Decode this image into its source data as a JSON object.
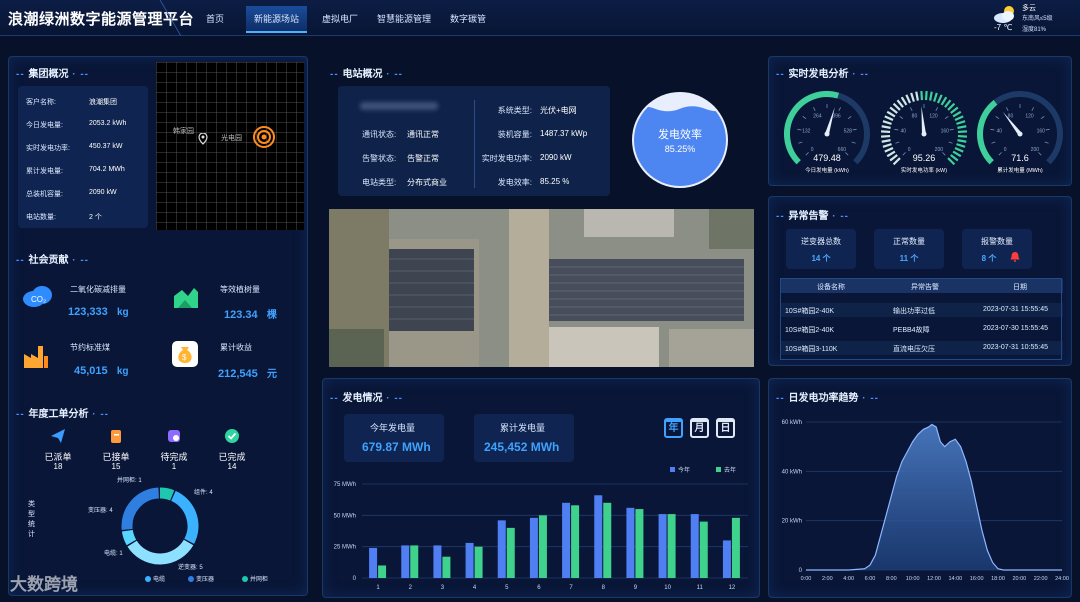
{
  "header": {
    "title": "浪潮绿洲数字能源管理平台",
    "nav": [
      "首页",
      "新能源场站",
      "虚拟电厂",
      "智慧能源管理",
      "数字碳管"
    ],
    "active_nav": 1,
    "weather": {
      "condition": "多云",
      "wind": "东南风≤5级",
      "temp": "-7 ℃",
      "humidity": "湿度81%"
    }
  },
  "group": {
    "title": "集团概况",
    "rows": [
      {
        "label": "客户名称:",
        "value": "浪潮集团"
      },
      {
        "label": "今日发电量:",
        "value": "2053.2 kWh"
      },
      {
        "label": "实时发电功率:",
        "value": "450.37 kW"
      },
      {
        "label": "累计发电量:",
        "value": "704.2 MWh"
      },
      {
        "label": "总装机容量:",
        "value": "2090 kW"
      },
      {
        "label": "电站数量:",
        "value": "2 个"
      }
    ],
    "map_labels": [
      "韩家园",
      "光电园"
    ]
  },
  "social": {
    "title": "社会贡献",
    "items": [
      {
        "label": "二氧化碳减排量",
        "value": "123,333",
        "unit": "kg",
        "icon": "co2-icon",
        "color": "#2f8cff"
      },
      {
        "label": "等效植树量",
        "value": "123.34",
        "unit": "棵",
        "icon": "tree-icon",
        "color": "#2fd48a"
      },
      {
        "label": "节约标准煤",
        "value": "45,015",
        "unit": "kg",
        "icon": "factory-icon",
        "color": "#ffa531"
      },
      {
        "label": "累计收益",
        "value": "212,545",
        "unit": "元",
        "icon": "money-bag-icon",
        "color": "#ffb531"
      }
    ],
    "co2_text": "CO₂"
  },
  "workorder": {
    "title": "年度工单分析",
    "stats": [
      {
        "label": "已派单",
        "value": "18",
        "icon": "send-icon",
        "color": "#3b9dff"
      },
      {
        "label": "已接单",
        "value": "15",
        "icon": "clipboard-icon",
        "color": "#ff9a3c"
      },
      {
        "label": "待完成",
        "value": "1",
        "icon": "clock-icon",
        "color": "#8c6bff"
      },
      {
        "label": "已完成",
        "value": "14",
        "icon": "check-icon",
        "color": "#2fd4a0"
      }
    ],
    "type_label": "类型统计",
    "donut_labels": [
      {
        "text": "并网柜: 1"
      },
      {
        "text": "组件: 4"
      },
      {
        "text": "变压器: 4"
      },
      {
        "text": "电缆: 1"
      },
      {
        "text": "逆变器: 5"
      }
    ],
    "legend": [
      "电缆",
      "变压器",
      "并网柜"
    ],
    "colors": [
      "#3bb2ff",
      "#58d6ff",
      "#2f7fe0",
      "#1fc7b0",
      "#8ee0ff"
    ]
  },
  "station": {
    "title": "电站概况",
    "name_blurred": "",
    "left_rows": [
      {
        "label": "通讯状态:",
        "value": "通讯正常"
      },
      {
        "label": "告警状态:",
        "value": "告警正常"
      },
      {
        "label": "电站类型:",
        "value": "分布式商业"
      }
    ],
    "right_rows": [
      {
        "label": "系统类型:",
        "value": "光伏+电网"
      },
      {
        "label": "装机容量:",
        "value": "1487.37 kWp"
      },
      {
        "label": "实时发电功率:",
        "value": "2090 kW"
      },
      {
        "label": "发电效率:",
        "value": "85.25 %"
      }
    ],
    "efficiency": {
      "label": "发电效率",
      "value": "85.25%",
      "fraction": 0.8525
    }
  },
  "power": {
    "title": "发电情况",
    "year_label": "今年发电量",
    "year_value": "679.87 MWh",
    "total_label": "累计发电量",
    "total_value": "245,452 MWh",
    "period_buttons": [
      "年",
      "月",
      "日"
    ]
  },
  "realtime": {
    "title": "实时发电分析",
    "gauges": [
      {
        "label": "今日发电量 (kWh)",
        "value": "479.48",
        "fraction": 0.56,
        "color": "#3fcf9a",
        "ticks": [
          "0",
          "132",
          "264",
          "396",
          "528",
          "660"
        ]
      },
      {
        "label": "实时发电功率 (kW)",
        "value": "95.26",
        "fraction": 0.48,
        "color": "#bfe6e0",
        "ticks": [
          "0",
          "40",
          "80",
          "120",
          "160",
          "200"
        ]
      },
      {
        "label": "累计发电量 (MWh)",
        "value": "71.6",
        "fraction": 0.36,
        "color": "#3fcf9a",
        "ticks": [
          "0",
          "40",
          "80",
          "120",
          "160",
          "200"
        ]
      }
    ]
  },
  "alarm": {
    "title": "异常告警",
    "stats": [
      {
        "label": "逆变器总数",
        "value": "14 个"
      },
      {
        "label": "正常数量",
        "value": "11 个"
      },
      {
        "label": "报警数量",
        "value": "8 个"
      }
    ],
    "columns": [
      "设备名称",
      "异常告警",
      "日期"
    ],
    "rows": [
      [
        "10S#箱园2-40K",
        "输出功率过低",
        "2023-07-31 15:55:45"
      ],
      [
        "10S#箱园2-40K",
        "PEBB4故障",
        "2023-07-30 15:55:45"
      ],
      [
        "10S#箱园3-110K",
        "直流电压欠压",
        "2023-07-31 10:55:45"
      ]
    ]
  },
  "trend": {
    "title": "日发电功率趋势"
  },
  "watermark": "大数跨境",
  "chart_data": [
    {
      "type": "bar",
      "categories": [
        "1",
        "2",
        "3",
        "4",
        "5",
        "6",
        "7",
        "8",
        "9",
        "10",
        "11",
        "12"
      ],
      "series": [
        {
          "name": "今年",
          "values": [
            24,
            26,
            26,
            28,
            46,
            48,
            60,
            66,
            56,
            51,
            51,
            30
          ],
          "color": "#4f7ff2"
        },
        {
          "name": "去年",
          "values": [
            10,
            26,
            17,
            25,
            40,
            50,
            58,
            60,
            55,
            51,
            45,
            48
          ],
          "color": "#3fd28c"
        }
      ],
      "yticks": [
        "0",
        "25 MWh",
        "50 MWh",
        "75 MWh"
      ],
      "ylim": [
        0,
        75
      ]
    },
    {
      "type": "area",
      "x": [
        "0:00",
        "2:00",
        "4:00",
        "6:00",
        "8:00",
        "10:00",
        "12:00",
        "14:00",
        "16:00",
        "18:00",
        "20:00",
        "22:00",
        "24:00"
      ],
      "points": [
        [
          0,
          0
        ],
        [
          2,
          0
        ],
        [
          4,
          0
        ],
        [
          5.5,
          0.5
        ],
        [
          6,
          2
        ],
        [
          6.5,
          6
        ],
        [
          7,
          14
        ],
        [
          7.5,
          22
        ],
        [
          8,
          30
        ],
        [
          8.5,
          38
        ],
        [
          9,
          44
        ],
        [
          9.5,
          48
        ],
        [
          10,
          52
        ],
        [
          10.5,
          55
        ],
        [
          11,
          57
        ],
        [
          11.5,
          58
        ],
        [
          11.8,
          59
        ],
        [
          12.2,
          58
        ],
        [
          12.6,
          52
        ],
        [
          13,
          50
        ],
        [
          13.5,
          52
        ],
        [
          14,
          53
        ],
        [
          14.5,
          50
        ],
        [
          15,
          44
        ],
        [
          15.5,
          36
        ],
        [
          16,
          26
        ],
        [
          16.5,
          16
        ],
        [
          17,
          8
        ],
        [
          17.5,
          3
        ],
        [
          18,
          0.5
        ],
        [
          18.5,
          0
        ],
        [
          24,
          0
        ]
      ],
      "yticks": [
        "0",
        "20 kWh",
        "40 kWh",
        "60 kWh"
      ],
      "xticks": [
        "0:00",
        "2:00",
        "4:00",
        "6:00",
        "8:00",
        "10:00",
        "12:00",
        "14:00",
        "16:00",
        "18:00",
        "20:00",
        "22:00",
        "24:00"
      ],
      "ylim": [
        0,
        60
      ],
      "xlim": [
        0,
        24
      ]
    }
  ]
}
